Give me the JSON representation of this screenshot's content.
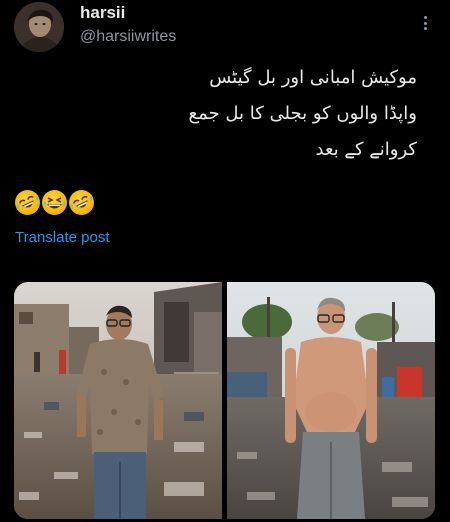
{
  "post": {
    "display_name": "harsii",
    "handle": "@harsiiwrites",
    "text_lines": [
      "موکیش امبانی اور بل گیٹس",
      "واپڈا والوں کو بجلی کا بل جمع",
      "کروانے کے بعد"
    ],
    "emojis": [
      "rolling-on-floor-laughing",
      "grinning-squinting-face",
      "rolling-on-floor-laughing"
    ],
    "translate_label": "Translate post"
  },
  "media": {
    "images": [
      {
        "name": "slum-man-left",
        "alt": ""
      },
      {
        "name": "slum-man-right",
        "alt": ""
      }
    ]
  },
  "colors": {
    "background": "#000000",
    "text": "#e7e9ea",
    "secondary_text": "#8b98a5",
    "link": "#1d9bf0"
  }
}
